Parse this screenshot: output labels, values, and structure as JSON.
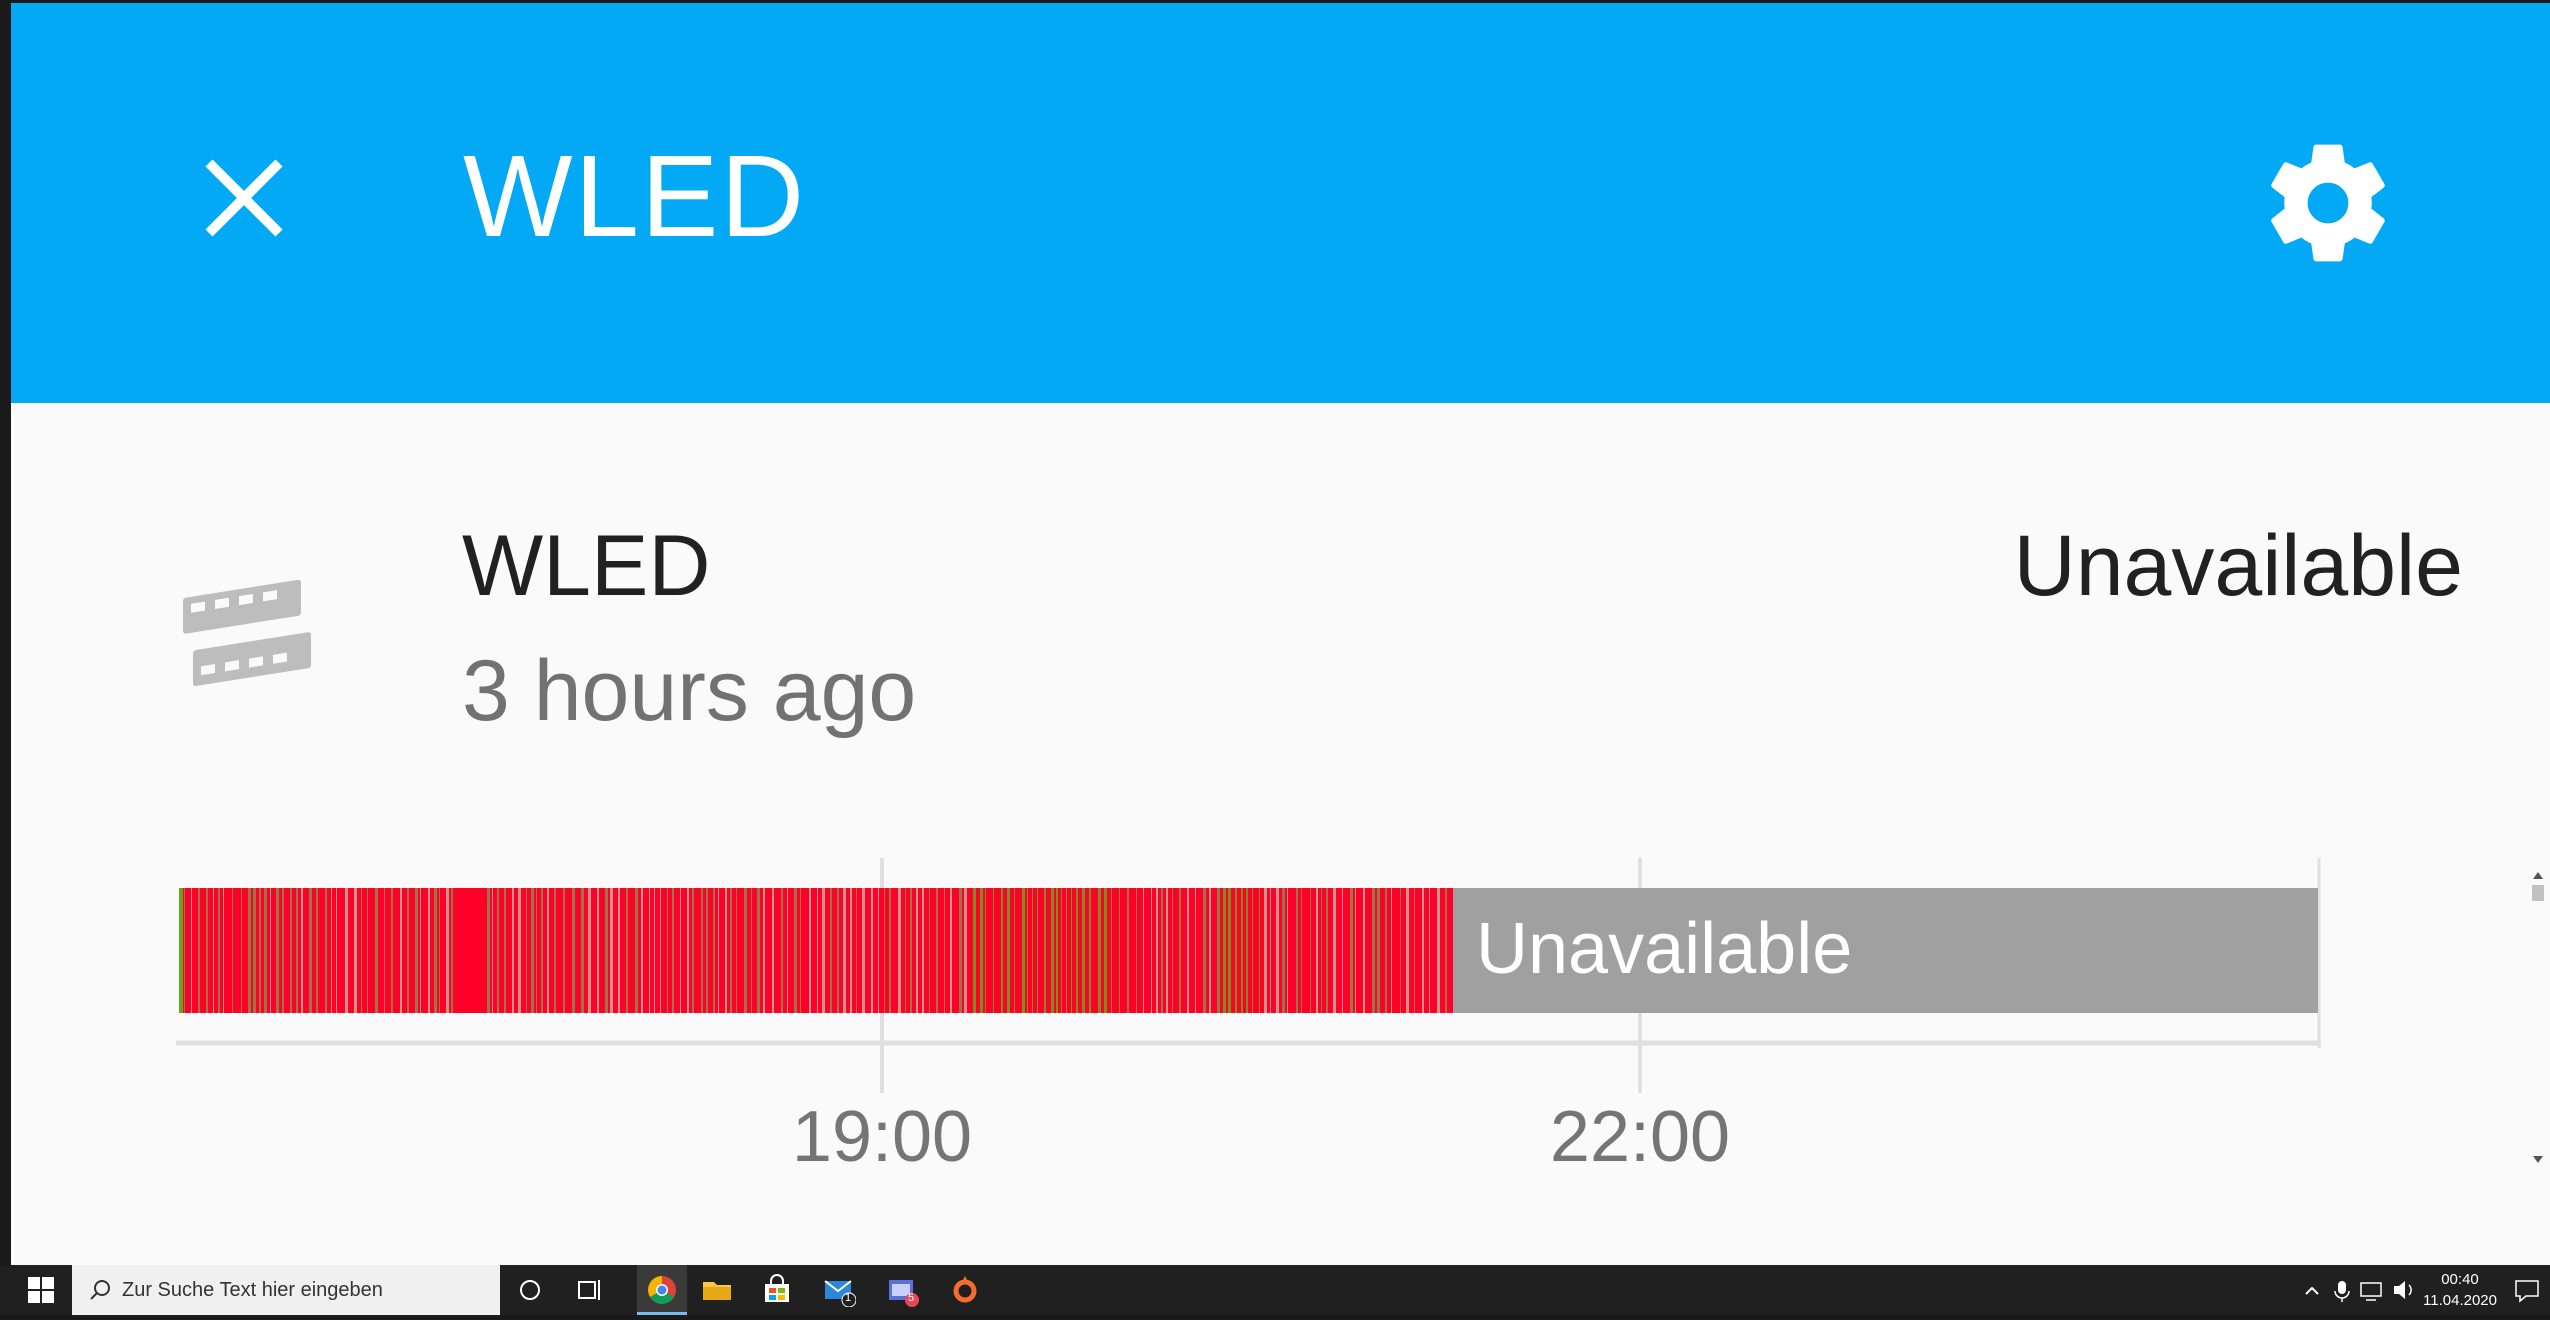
{
  "header": {
    "title": "WLED"
  },
  "entity": {
    "name": "WLED",
    "last_changed": "3 hours ago",
    "state": "Unavailable"
  },
  "timeline": {
    "segment_label": "Unavailable",
    "ticks": [
      "19:00",
      "22:00"
    ],
    "colors": {
      "red": "#ff0029",
      "green": "#66a61e",
      "unavailable": "#a0a0a0"
    }
  },
  "taskbar": {
    "search_placeholder": "Zur Suche Text hier eingeben",
    "time": "00:40",
    "date": "11.04.2020",
    "mail_badge": "1",
    "app_badge": "5"
  },
  "colors": {
    "header": "#03a9f4",
    "background": "#fafafa",
    "taskbar": "#202020"
  }
}
